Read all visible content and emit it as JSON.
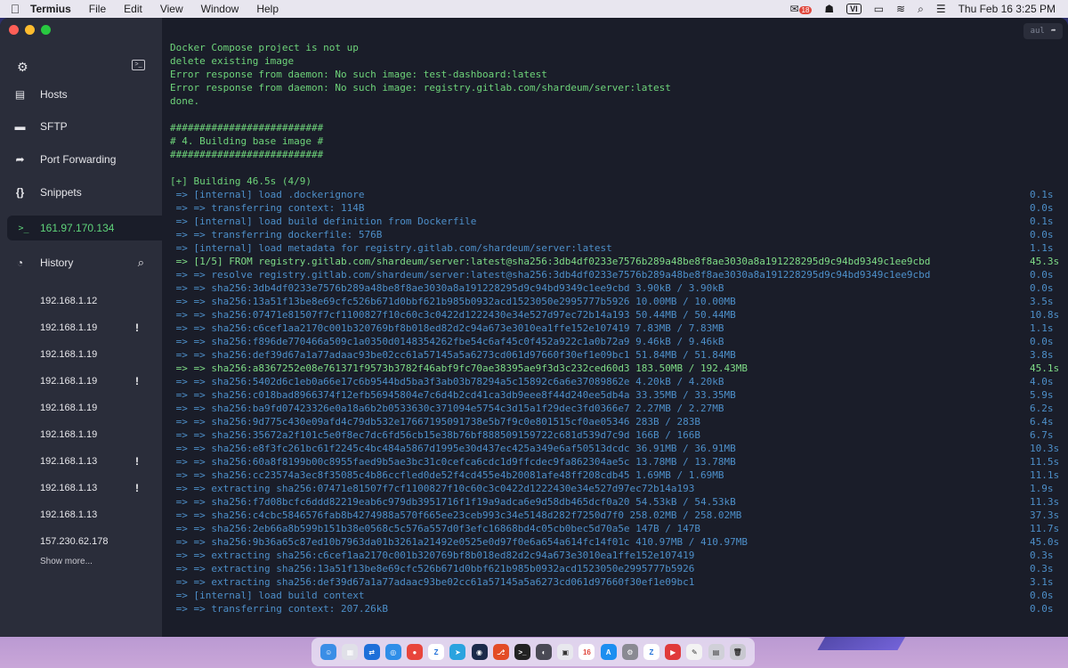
{
  "menubar": {
    "app_name": "Termius",
    "menus": [
      "File",
      "Edit",
      "View",
      "Window",
      "Help"
    ],
    "input_source": "VI",
    "datetime": "Thu Feb 16  3:25 PM",
    "notification_badge": "18"
  },
  "sidebar": {
    "nav": [
      {
        "label": "Hosts",
        "icon": "server-stack-icon"
      },
      {
        "label": "SFTP",
        "icon": "folder-icon"
      },
      {
        "label": "Port Forwarding",
        "icon": "port-forward-icon"
      },
      {
        "label": "Snippets",
        "icon": "braces-icon"
      }
    ],
    "active_session": "161.97.170.134",
    "history_label": "History",
    "history": [
      {
        "host": "192.168.1.12",
        "warning": false
      },
      {
        "host": "192.168.1.19",
        "warning": true
      },
      {
        "host": "192.168.1.19",
        "warning": false
      },
      {
        "host": "192.168.1.19",
        "warning": true
      },
      {
        "host": "192.168.1.19",
        "warning": false
      },
      {
        "host": "192.168.1.19",
        "warning": false
      },
      {
        "host": "192.168.1.13",
        "warning": true
      },
      {
        "host": "192.168.1.13",
        "warning": true
      },
      {
        "host": "192.168.1.13",
        "warning": false
      },
      {
        "host": "157.230.62.178",
        "warning": false
      }
    ],
    "show_more": "Show more..."
  },
  "terminal": {
    "top_button_label": "aul",
    "lines": [
      {
        "text": "Docker Compose project is not up",
        "color": "green"
      },
      {
        "text": "delete existing image",
        "color": "green"
      },
      {
        "text": "Error response from daemon: No such image: test-dashboard:latest",
        "color": "green"
      },
      {
        "text": "Error response from daemon: No such image: registry.gitlab.com/shardeum/server:latest",
        "color": "green"
      },
      {
        "text": "done.",
        "color": "green"
      },
      {
        "text": "",
        "color": "green"
      },
      {
        "text": "##########################",
        "color": "green"
      },
      {
        "text": "# 4. Building base image #",
        "color": "green"
      },
      {
        "text": "##########################",
        "color": "green"
      },
      {
        "text": "",
        "color": "green"
      },
      {
        "text": "[+] Building 46.5s (4/9)",
        "color": "green"
      },
      {
        "text": " => [internal] load .dockerignore",
        "color": "blue",
        "time": "0.1s"
      },
      {
        "text": " => => transferring context: 114B",
        "color": "blue",
        "time": "0.0s"
      },
      {
        "text": " => [internal] load build definition from Dockerfile",
        "color": "blue",
        "time": "0.1s"
      },
      {
        "text": " => => transferring dockerfile: 576B",
        "color": "blue",
        "time": "0.0s"
      },
      {
        "text": " => [internal] load metadata for registry.gitlab.com/shardeum/server:latest",
        "color": "blue",
        "time": "1.1s"
      },
      {
        "text": " => [1/5] FROM registry.gitlab.com/shardeum/server:latest@sha256:3db4df0233e7576b289a48be8f8ae3030a8a191228295d9c94bd9349c1ee9cbd",
        "color": "bright",
        "time": "45.3s"
      },
      {
        "text": " => => resolve registry.gitlab.com/shardeum/server:latest@sha256:3db4df0233e7576b289a48be8f8ae3030a8a191228295d9c94bd9349c1ee9cbd",
        "color": "blue",
        "time": "0.0s"
      },
      {
        "text": " => => sha256:3db4df0233e7576b289a48be8f8ae3030a8a191228295d9c94bd9349c1ee9cbd 3.90kB / 3.90kB",
        "color": "blue",
        "time": "0.0s"
      },
      {
        "text": " => => sha256:13a51f13be8e69cfc526b671d0bbf621b985b0932acd1523050e2995777b5926 10.00MB / 10.00MB",
        "color": "blue",
        "time": "3.5s"
      },
      {
        "text": " => => sha256:07471e81507f7cf1100827f10c60c3c0422d1222430e34e527d97ec72b14a193 50.44MB / 50.44MB",
        "color": "blue",
        "time": "10.8s"
      },
      {
        "text": " => => sha256:c6cef1aa2170c001b320769bf8b018ed82d2c94a673e3010ea1ffe152e107419 7.83MB / 7.83MB",
        "color": "blue",
        "time": "1.1s"
      },
      {
        "text": " => => sha256:f896de770466a509c1a0350d0148354262fbe54c6af45c0f452a922c1a0b72a9 9.46kB / 9.46kB",
        "color": "blue",
        "time": "0.0s"
      },
      {
        "text": " => => sha256:def39d67a1a77adaac93be02cc61a57145a5a6273cd061d97660f30ef1e09bc1 51.84MB / 51.84MB",
        "color": "blue",
        "time": "3.8s"
      },
      {
        "text": " => => sha256:a8367252e08e761371f9573b3782f46abf9fc70ae38395ae9f3d3c232ced60d3 183.50MB / 192.43MB",
        "color": "bright",
        "time": "45.1s"
      },
      {
        "text": " => => sha256:5402d6c1eb0a66e17c6b9544bd5ba3f3ab03b78294a5c15892c6a6e37089862e 4.20kB / 4.20kB",
        "color": "blue",
        "time": "4.0s"
      },
      {
        "text": " => => sha256:c018bad8966374f12efb56945804e7c6d4b2cd41ca3db9eee8f44d240ee5db4a 33.35MB / 33.35MB",
        "color": "blue",
        "time": "5.9s"
      },
      {
        "text": " => => sha256:ba9fd07423326e0a18a6b2b0533630c371094e5754c3d15a1f29dec3fd0366e7 2.27MB / 2.27MB",
        "color": "blue",
        "time": "6.2s"
      },
      {
        "text": " => => sha256:9d775c430e09afd4c79db532e17667195091738e5b7f9c0e801515cf0ae05346 283B / 283B",
        "color": "blue",
        "time": "6.4s"
      },
      {
        "text": " => => sha256:35672a2f101c5e0f8ec7dc6fd56cb15e38b76bf888509159722c681d539d7c9d 166B / 166B",
        "color": "blue",
        "time": "6.7s"
      },
      {
        "text": " => => sha256:e8f3fc261bc61f2245c4bc484a5867d1995e30d437ec425a349e6af50513dcdc 36.91MB / 36.91MB",
        "color": "blue",
        "time": "10.3s"
      },
      {
        "text": " => => sha256:60a8f8199b00c8955faed9b5ae3bc31c0cefca6cdc1d9ffcdec9fa862304ae5c 13.78MB / 13.78MB",
        "color": "blue",
        "time": "11.5s"
      },
      {
        "text": " => => sha256:cc23574a3ec8f35085c4b86ccfled0de52f4cd455e4b20081afe48ff208cdb45 1.69MB / 1.69MB",
        "color": "blue",
        "time": "11.1s"
      },
      {
        "text": " => => extracting sha256:07471e81507f7cf1100827f10c60c3c0422d1222430e34e527d97ec72b14a193",
        "color": "blue",
        "time": "1.9s"
      },
      {
        "text": " => => sha256:f7d08bcfc6ddd82219eab6c979db3951716f1f19a9adca6e9d58db465dcf0a20 54.53kB / 54.53kB",
        "color": "blue",
        "time": "11.3s"
      },
      {
        "text": " => => sha256:c4cbc5846576fab8b4274988a570f665ee23ceb993c34e5148d282f7250d7f0 258.02MB / 258.02MB",
        "color": "blue",
        "time": "37.3s"
      },
      {
        "text": " => => sha256:2eb66a8b599b151b38e0568c5c576a557d0f3efc16868bd4c05cb0bec5d70a5e 147B / 147B",
        "color": "blue",
        "time": "11.7s"
      },
      {
        "text": " => => sha256:9b36a65c87ed10b7963da01b3261a21492e0525e0d97f0e6a654a614fc14f01c 410.97MB / 410.97MB",
        "color": "blue",
        "time": "45.0s"
      },
      {
        "text": " => => extracting sha256:c6cef1aa2170c001b320769bf8b018ed82d2c94a673e3010ea1ffe152e107419",
        "color": "blue",
        "time": "0.3s"
      },
      {
        "text": " => => extracting sha256:13a51f13be8e69cfc526b671d0bbf621b985b0932acd1523050e2995777b5926",
        "color": "blue",
        "time": "0.3s"
      },
      {
        "text": " => => extracting sha256:def39d67a1a77adaac93be02cc61a57145a5a6273cd061d97660f30ef1e09bc1",
        "color": "blue",
        "time": "3.1s"
      },
      {
        "text": " => [internal] load build context",
        "color": "blue",
        "time": "0.0s"
      },
      {
        "text": " => => transferring context: 207.26kB",
        "color": "blue",
        "time": "0.0s"
      }
    ]
  },
  "dock": {
    "apps": [
      {
        "name": "finder-icon",
        "color": "#3a8ee6",
        "glyph": "☺"
      },
      {
        "name": "launchpad-icon",
        "color": "#e0e0e8",
        "glyph": "▦"
      },
      {
        "name": "teamviewer-icon",
        "color": "#1e6fd9",
        "glyph": "⇄"
      },
      {
        "name": "safari-icon",
        "color": "#2f8ee8",
        "glyph": "◎"
      },
      {
        "name": "chrome-icon",
        "color": "#e8453c",
        "glyph": "●"
      },
      {
        "name": "zalo-icon",
        "color": "#ffffff",
        "glyph": "Z",
        "text": "#1e6fd9"
      },
      {
        "name": "telegram-icon",
        "color": "#2aa3df",
        "glyph": "➤"
      },
      {
        "name": "vpn-icon",
        "color": "#1b2a4a",
        "glyph": "◉"
      },
      {
        "name": "git-icon",
        "color": "#e34c26",
        "glyph": "⎇"
      },
      {
        "name": "terminal-icon",
        "color": "#222222",
        "glyph": ">_"
      },
      {
        "name": "screenshot-icon",
        "color": "#4a4a55",
        "glyph": "◐"
      },
      {
        "name": "preview-icon",
        "color": "#e8e8ee",
        "glyph": "▣",
        "text": "#333"
      },
      {
        "name": "calendar-icon",
        "color": "#ffffff",
        "glyph": "16",
        "text": "#e0473c"
      },
      {
        "name": "app-store-icon",
        "color": "#1c8ef0",
        "glyph": "A"
      },
      {
        "name": "system-preferences-icon",
        "color": "#8a8a92",
        "glyph": "⚙"
      },
      {
        "name": "zalo-2-icon",
        "color": "#ffffff",
        "glyph": "Z",
        "text": "#1e6fd9"
      },
      {
        "name": "termius-icon",
        "color": "#e03a3a",
        "glyph": "▶"
      },
      {
        "name": "textedit-icon",
        "color": "#f3f3f3",
        "glyph": "✎",
        "text": "#333"
      },
      {
        "name": "photos-icon",
        "color": "#d0d0d8",
        "glyph": "▤",
        "text": "#333"
      },
      {
        "name": "trash-icon",
        "color": "#c8c8d0",
        "glyph": "🗑",
        "text": "#333"
      }
    ]
  }
}
